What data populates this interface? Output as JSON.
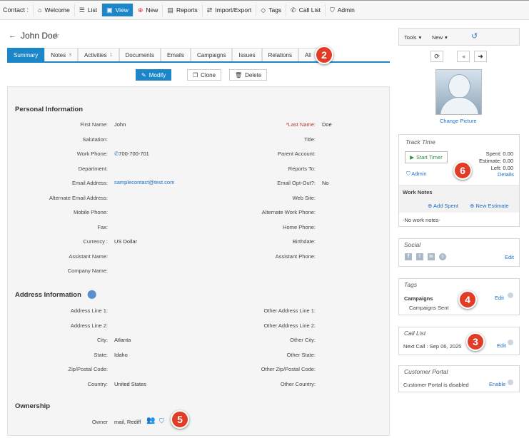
{
  "topnav": {
    "label": "Contact :",
    "items": [
      {
        "label": "Welcome",
        "icon": "home-icon"
      },
      {
        "label": "List",
        "icon": "list-icon"
      },
      {
        "label": "View",
        "icon": "view-icon",
        "active": true
      },
      {
        "label": "New",
        "icon": "new-icon"
      },
      {
        "label": "Reports",
        "icon": "reports-icon"
      },
      {
        "label": "Import/Export",
        "icon": "import-export-icon"
      },
      {
        "label": "Tags",
        "icon": "tag-icon"
      },
      {
        "label": "Call List",
        "icon": "phone-icon"
      },
      {
        "label": "Admin",
        "icon": "shield-icon"
      }
    ]
  },
  "page": {
    "title": "John Doe"
  },
  "tabs": [
    {
      "label": "Summary",
      "count": ""
    },
    {
      "label": "Notes",
      "count": "3"
    },
    {
      "label": "Activities",
      "count": "1"
    },
    {
      "label": "Documents",
      "count": ""
    },
    {
      "label": "Emails",
      "count": ""
    },
    {
      "label": "Campaigns",
      "count": ""
    },
    {
      "label": "Issues",
      "count": ""
    },
    {
      "label": "Relations",
      "count": ""
    },
    {
      "label": "All",
      "count": ""
    }
  ],
  "actions": {
    "modify": "Modify",
    "clone": "Clone",
    "delete": "Delete"
  },
  "badges": {
    "b2": "2",
    "b3": "3",
    "b4": "4",
    "b5": "5",
    "b6": "6"
  },
  "personal": {
    "title": "Personal Information",
    "left": [
      {
        "label": "First Name:",
        "value": "John"
      },
      {
        "label": "Salutation:",
        "value": ""
      },
      {
        "label": "Work Phone:",
        "value": "700-700-701"
      },
      {
        "label": "Department:",
        "value": ""
      },
      {
        "label": "Email Address:",
        "value": "samplecontact@test.com"
      },
      {
        "label": "Alternate Email Address:",
        "value": ""
      },
      {
        "label": "Mobile Phone:",
        "value": ""
      },
      {
        "label": "Fax:",
        "value": ""
      },
      {
        "label": "Currency :",
        "value": "US Dollar"
      },
      {
        "label": "Assistant Name:",
        "value": ""
      },
      {
        "label": "Company Name:",
        "value": ""
      }
    ],
    "right": [
      {
        "label": "Last Name:",
        "required": "*",
        "value": "Doe"
      },
      {
        "label": "Title:",
        "value": ""
      },
      {
        "label": "Parent Account:",
        "value": ""
      },
      {
        "label": "Reports To:",
        "value": ""
      },
      {
        "label": "Email Opt-Out?:",
        "value": "No"
      },
      {
        "label": "Web Site:",
        "value": ""
      },
      {
        "label": "Alternate Work Phone:",
        "value": ""
      },
      {
        "label": "Home Phone:",
        "value": ""
      },
      {
        "label": "Birthdate:",
        "value": ""
      },
      {
        "label": "Assistant Phone:",
        "value": ""
      }
    ]
  },
  "address": {
    "title": "Address Information",
    "left": [
      {
        "label": "Address Line 1:",
        "value": ""
      },
      {
        "label": "Address Line 2:",
        "value": ""
      },
      {
        "label": "City:",
        "value": "Atlanta"
      },
      {
        "label": "State:",
        "value": "Idaho"
      },
      {
        "label": "Zip/Postal Code:",
        "value": ""
      },
      {
        "label": "Country:",
        "value": "United States"
      }
    ],
    "right": [
      {
        "label": "Other Address Line 1:",
        "value": ""
      },
      {
        "label": "Other Address Line 2:",
        "value": ""
      },
      {
        "label": "Other City:",
        "value": ""
      },
      {
        "label": "Other State:",
        "value": ""
      },
      {
        "label": "Other Zip/Postal Code:",
        "value": ""
      },
      {
        "label": "Other Country:",
        "value": ""
      }
    ]
  },
  "ownership": {
    "title": "Ownership",
    "label": "Owner",
    "value": "mail, Rediff"
  },
  "sidebar": {
    "tools": "Tools",
    "new": "New",
    "change_picture": "Change Picture",
    "track_time": {
      "title": "Track Time",
      "start_timer": "Start Timer",
      "admin": "Admin",
      "spent_label": "Spent:",
      "spent": "0.00",
      "estimate_label": "Estimate:",
      "estimate": "0.00",
      "left_label": "Left:",
      "left": "0.00",
      "details": "Details",
      "work_notes": "Work Notes",
      "add_spent": "Add Spent",
      "new_estimate": "New Estimate",
      "no_notes": "-No work notes-"
    },
    "social": {
      "title": "Social",
      "edit": "Edit"
    },
    "tags": {
      "title": "Tags",
      "group": "Campaigns",
      "item": "Campaigns Sent",
      "edit": "Edit"
    },
    "call_list": {
      "title": "Call List",
      "next_call": "Next Call : Sep 06, 2025",
      "edit": "Edit"
    },
    "portal": {
      "title": "Customer Portal",
      "status": "Customer Portal is disabled",
      "enable": "Enable"
    }
  },
  "colors": {
    "accent": "#1b87c9",
    "badge": "#e23b26",
    "link": "#1b6fc2",
    "required": "#c0392b"
  }
}
